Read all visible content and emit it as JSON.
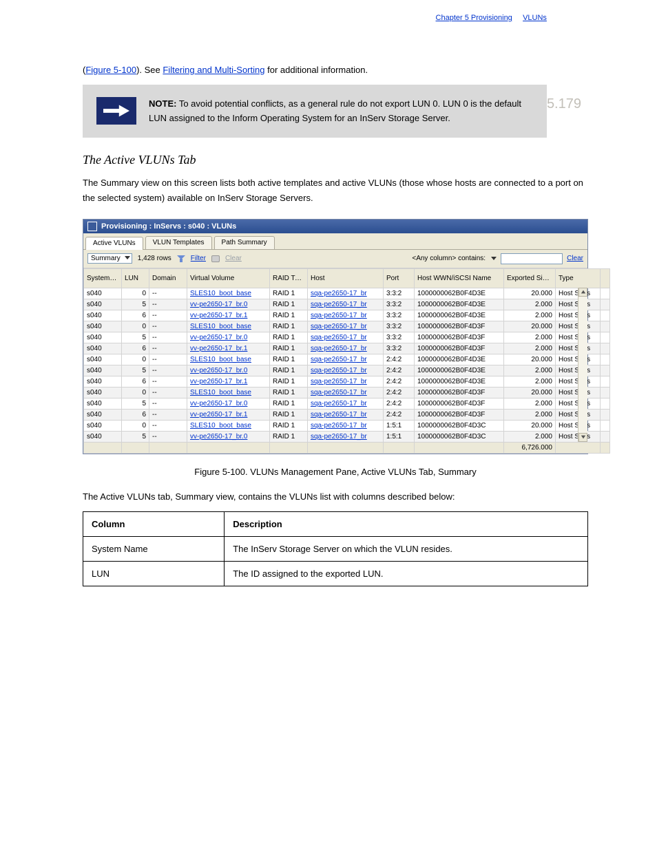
{
  "page_header": {
    "chapter_num": "5.179",
    "crumb_a": "Chapter 5 Provisioning",
    "crumb_b": "VLUNs"
  },
  "intro": {
    "before": "(",
    "link1": "Figure 5-100",
    "mid": "). See ",
    "link2": "Filtering and Multi-Sorting",
    "after": " for additional information."
  },
  "note": {
    "label": "NOTE:",
    "body": " To avoid potential conflicts, as a general rule do not export LUN 0. LUN 0 is the default LUN assigned to the Inform Operating System for an InServ Storage Server."
  },
  "sections": {
    "active_head": "The Active VLUNs Tab",
    "active_para": "The Summary view on this screen lists both active templates and active VLUNs (those whose hosts are connected to a port on the selected system) available on InServ Storage Servers.",
    "figcap": "Figure 5-100.  VLUNs Management Pane, Active VLUNs Tab, Summary",
    "desc_intro": "The Active VLUNs tab, Summary view, contains the VLUNs list with columns described below:"
  },
  "desc_table": {
    "head_col": "Column",
    "head_desc": "Description",
    "rows": [
      {
        "c": "System Name",
        "d": "The InServ Storage Server on which the VLUN resides."
      },
      {
        "c": "LUN",
        "d": "The ID assigned to the exported LUN."
      }
    ]
  },
  "window": {
    "title": "Provisioning : InServs : s040 : VLUNs",
    "tabs": [
      "Active VLUNs",
      "VLUN Templates",
      "Path Summary"
    ],
    "view_combo": "Summary",
    "row_count": "1,428 rows",
    "filter_label": "Filter",
    "clear_label": "Clear",
    "search_label": "<Any column> contains:",
    "clear2": "Clear",
    "columns": [
      "System Name",
      "LUN",
      "Domain",
      "Virtual Volume",
      "RAID Type",
      "Host",
      "Port",
      "Host WWN/iSCSI Name",
      "Exported Size (GiB)",
      "Type"
    ],
    "rows": [
      {
        "alt": false,
        "sys": "s040",
        "lun": "0",
        "dom": "--",
        "vv": "SLES10_boot_base",
        "raid": "RAID 1",
        "host": "sqa-pe2650-17_br",
        "port": "3:3:2",
        "wwn": "1000000062B0F4D3E",
        "size": "20.000",
        "type": "Host Sees"
      },
      {
        "alt": true,
        "sys": "s040",
        "lun": "5",
        "dom": "--",
        "vv": "vv-pe2650-17_br.0",
        "raid": "RAID 1",
        "host": "sqa-pe2650-17_br",
        "port": "3:3:2",
        "wwn": "1000000062B0F4D3E",
        "size": "2.000",
        "type": "Host Sees"
      },
      {
        "alt": false,
        "sys": "s040",
        "lun": "6",
        "dom": "--",
        "vv": "vv-pe2650-17_br.1",
        "raid": "RAID 1",
        "host": "sqa-pe2650-17_br",
        "port": "3:3:2",
        "wwn": "1000000062B0F4D3E",
        "size": "2.000",
        "type": "Host Sees"
      },
      {
        "alt": true,
        "sys": "s040",
        "lun": "0",
        "dom": "--",
        "vv": "SLES10_boot_base",
        "raid": "RAID 1",
        "host": "sqa-pe2650-17_br",
        "port": "3:3:2",
        "wwn": "1000000062B0F4D3F",
        "size": "20.000",
        "type": "Host Sees"
      },
      {
        "alt": false,
        "sys": "s040",
        "lun": "5",
        "dom": "--",
        "vv": "vv-pe2650-17_br.0",
        "raid": "RAID 1",
        "host": "sqa-pe2650-17_br",
        "port": "3:3:2",
        "wwn": "1000000062B0F4D3F",
        "size": "2.000",
        "type": "Host Sees"
      },
      {
        "alt": true,
        "sys": "s040",
        "lun": "6",
        "dom": "--",
        "vv": "vv-pe2650-17_br.1",
        "raid": "RAID 1",
        "host": "sqa-pe2650-17_br",
        "port": "3:3:2",
        "wwn": "1000000062B0F4D3F",
        "size": "2.000",
        "type": "Host Sees"
      },
      {
        "alt": false,
        "sys": "s040",
        "lun": "0",
        "dom": "--",
        "vv": "SLES10_boot_base",
        "raid": "RAID 1",
        "host": "sqa-pe2650-17_br",
        "port": "2:4:2",
        "wwn": "1000000062B0F4D3E",
        "size": "20.000",
        "type": "Host Sees"
      },
      {
        "alt": true,
        "sys": "s040",
        "lun": "5",
        "dom": "--",
        "vv": "vv-pe2650-17_br.0",
        "raid": "RAID 1",
        "host": "sqa-pe2650-17_br",
        "port": "2:4:2",
        "wwn": "1000000062B0F4D3E",
        "size": "2.000",
        "type": "Host Sees"
      },
      {
        "alt": false,
        "sys": "s040",
        "lun": "6",
        "dom": "--",
        "vv": "vv-pe2650-17_br.1",
        "raid": "RAID 1",
        "host": "sqa-pe2650-17_br",
        "port": "2:4:2",
        "wwn": "1000000062B0F4D3E",
        "size": "2.000",
        "type": "Host Sees"
      },
      {
        "alt": true,
        "sys": "s040",
        "lun": "0",
        "dom": "--",
        "vv": "SLES10_boot_base",
        "raid": "RAID 1",
        "host": "sqa-pe2650-17_br",
        "port": "2:4:2",
        "wwn": "1000000062B0F4D3F",
        "size": "20.000",
        "type": "Host Sees"
      },
      {
        "alt": false,
        "sys": "s040",
        "lun": "5",
        "dom": "--",
        "vv": "vv-pe2650-17_br.0",
        "raid": "RAID 1",
        "host": "sqa-pe2650-17_br",
        "port": "2:4:2",
        "wwn": "1000000062B0F4D3F",
        "size": "2.000",
        "type": "Host Sees"
      },
      {
        "alt": true,
        "sys": "s040",
        "lun": "6",
        "dom": "--",
        "vv": "vv-pe2650-17_br.1",
        "raid": "RAID 1",
        "host": "sqa-pe2650-17_br",
        "port": "2:4:2",
        "wwn": "1000000062B0F4D3F",
        "size": "2.000",
        "type": "Host Sees"
      },
      {
        "alt": false,
        "sys": "s040",
        "lun": "0",
        "dom": "--",
        "vv": "SLES10_boot_base",
        "raid": "RAID 1",
        "host": "sqa-pe2650-17_br",
        "port": "1:5:1",
        "wwn": "1000000062B0F4D3C",
        "size": "20.000",
        "type": "Host Sees"
      },
      {
        "alt": true,
        "sys": "s040",
        "lun": "5",
        "dom": "--",
        "vv": "vv-pe2650-17_br.0",
        "raid": "RAID 1",
        "host": "sqa-pe2650-17_br",
        "port": "1:5:1",
        "wwn": "1000000062B0F4D3C",
        "size": "2.000",
        "type": "Host Sees"
      }
    ],
    "footer_total": "6,726.000"
  }
}
